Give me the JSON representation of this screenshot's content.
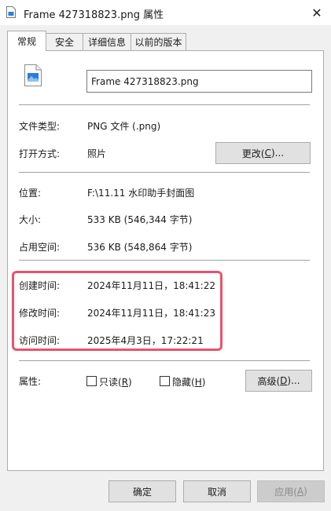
{
  "window": {
    "title": "Frame 427318823.png 属性",
    "close_glyph": "✕"
  },
  "tabs": [
    {
      "label": "常规",
      "active": true
    },
    {
      "label": "安全",
      "active": false
    },
    {
      "label": "详细信息",
      "active": false
    },
    {
      "label": "以前的版本",
      "active": false
    }
  ],
  "file": {
    "name": "Frame 427318823.png"
  },
  "type_section": {
    "file_type_label": "文件类型:",
    "file_type_value": "PNG 文件 (.png)",
    "open_with_label": "打开方式:",
    "open_with_value": "照片",
    "change_button": {
      "prefix": "更改(",
      "key": "C",
      "suffix": ")..."
    }
  },
  "location_section": {
    "location_label": "位置:",
    "location_value": "F:\\11.11 水印助手封面图",
    "size_label": "大小:",
    "size_value": "533 KB (546,344 字节)",
    "disk_size_label": "占用空间:",
    "disk_size_value": "536 KB (548,864 字节)"
  },
  "time_section": {
    "created_label": "创建时间:",
    "created_value": "2024年11月11日，18:41:22",
    "modified_label": "修改时间:",
    "modified_value": "2024年11月11日，18:41:23",
    "accessed_label": "访问时间:",
    "accessed_value": "2025年4月3日，17:22:21",
    "highlight_color": "#e8546b"
  },
  "attributes": {
    "label": "属性:",
    "readonly": {
      "checked": false,
      "prefix": "只读(",
      "key": "R",
      "suffix": ")"
    },
    "hidden": {
      "checked": false,
      "prefix": "隐藏(",
      "key": "H",
      "suffix": ")"
    },
    "advanced_button": {
      "prefix": "高级(",
      "key": "D",
      "suffix": ")..."
    }
  },
  "footer": {
    "ok": "确定",
    "cancel": "取消",
    "apply": {
      "prefix": "应用(",
      "key": "A",
      "suffix": ")",
      "disabled": true
    }
  }
}
